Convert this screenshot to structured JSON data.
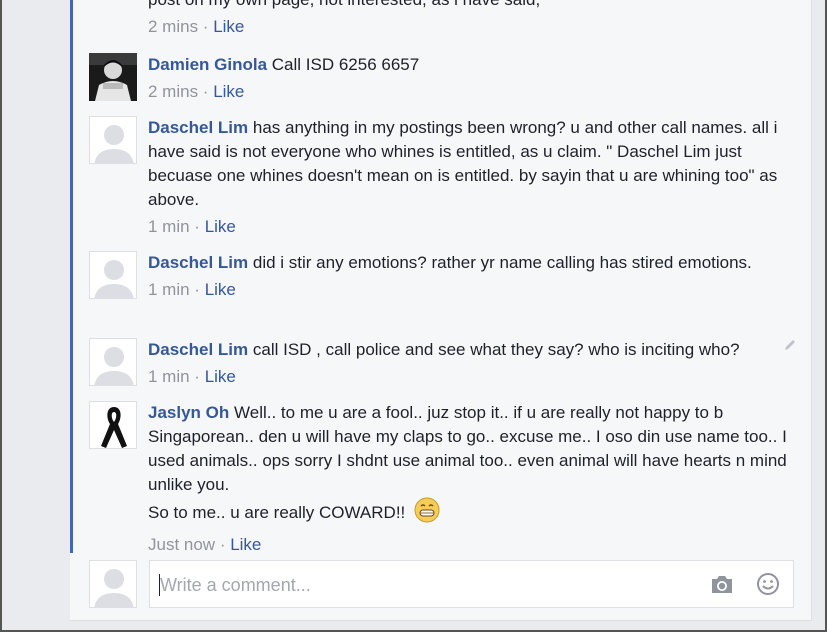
{
  "top_partial": {
    "text": "post on my own page, not interested, as i have said,",
    "time": "2 mins",
    "like": "Like"
  },
  "comments": [
    {
      "author": "Damien Ginola",
      "text": "Call ISD 6256 6657",
      "time": "2 mins",
      "like": "Like"
    },
    {
      "author": "Daschel Lim",
      "text": "has anything in my postings been wrong? u and other call names. all i have said is not everyone who whines is entitled, as u claim. \" Daschel Lim just becuase one whines doesn't mean on is entitled. by sayin that u are whining too\" as above.",
      "time": "1 min",
      "like": "Like"
    },
    {
      "author": "Daschel Lim",
      "text": "did i stir any emotions? rather yr name calling has stired emotions.",
      "time": "1 min",
      "like": "Like"
    },
    {
      "author": "Daschel Lim",
      "text": "call ISD , call police and see what they say? who is inciting who?",
      "time": "1 min",
      "like": "Like"
    },
    {
      "author": "Jaslyn Oh",
      "text": "Well.. to me u are a fool.. juz stop it.. if u are really not happy to b Singaporean.. den u will have my claps to go.. excuse me.. I oso din use name too.. I used animals.. ops sorry I shdnt use animal too.. even animal will have hearts n mind unlike you.",
      "text2": "So to me.. u are really COWARD!!",
      "time": "Just now",
      "like": "Like"
    }
  ],
  "composer": {
    "placeholder": "Write a comment..."
  },
  "separator": " · ",
  "icons": {
    "camera": "camera-icon",
    "emoji": "emoji-icon",
    "edit": "pencil-icon",
    "grin": "grinning-emoji"
  },
  "colors": {
    "link": "#365899",
    "meta": "#90949c",
    "thread": "#4267b2"
  }
}
